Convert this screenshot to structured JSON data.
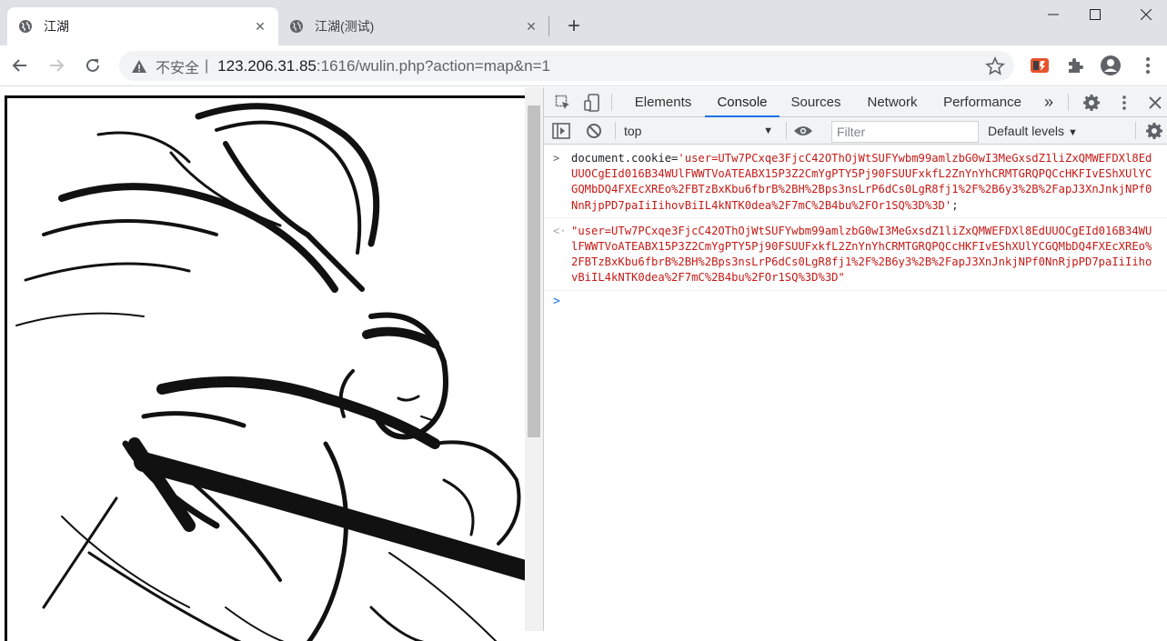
{
  "tabs": [
    {
      "title": "江湖",
      "active": true
    },
    {
      "title": "江湖(测试)",
      "active": false
    }
  ],
  "address": {
    "security_label": "不安全",
    "separator": "|",
    "host": "123.206.31.85",
    "path": ":1616/wulin.php?action=map&n=1"
  },
  "devtools": {
    "tabs": [
      "Elements",
      "Console",
      "Sources",
      "Network",
      "Performance"
    ],
    "active_tab": "Console",
    "more": "»",
    "context": "top",
    "filter_placeholder": "Filter",
    "levels": "Default levels"
  },
  "console": {
    "command_prefix": "document.cookie=",
    "command_value": "'user=UTw7PCxqe3FjcC42OThOjWtSUFYwbm99amlzbG0wI3MeGxsdZ1liZxQMWEFDXl8EdUUOCgEId016B34WUlFWWTVoATEABX15P3Z2CmYgPTY5Pj90FSUUFxkfL2ZnYnYhCRMTGRQPQCcHKFIvEShXUlYCGQMbDQ4FXEcXREo%2FBTzBxKbu6fbrB%2BH%2Bps3nsLrP6dCs0LgR8fj1%2F%2B6y3%2B%2FapJ3XnJnkjNPf0NnRjpPD7paIiIihovBiIL4kNTK0dea%2F7mC%2B4bu%2FOr1SQ%3D%3D'",
    "command_suffix": ";",
    "result": "\"user=UTw7PCxqe3FjcC42OThOjWtSUFYwbm99amlzbG0wI3MeGxsdZ1liZxQMWEFDXl8EdUUOCgEId016B34WUlFWWTVoATEABX15P3Z2CmYgPTY5Pj90FSUUFxkfL2ZnYnYhCRMTGRQPQCcHKFIvEShXUlYCGQMbDQ4FXEcXREo%2FBTzBxKbu6fbrB%2BH%2Bps3nsLrP6dCs0LgR8fj1%2F%2B6y3%2B%2FapJ3XnJnkjNPf0NnRjpPD7paIiIihovBiIL4kNTK0dea%2F7mC%2B4bu%2FOr1SQ%3D%3D\""
  },
  "colors": {
    "accent": "#1a73e8",
    "console_string": "#c41a16",
    "chrome_frame": "#dee1e6"
  }
}
